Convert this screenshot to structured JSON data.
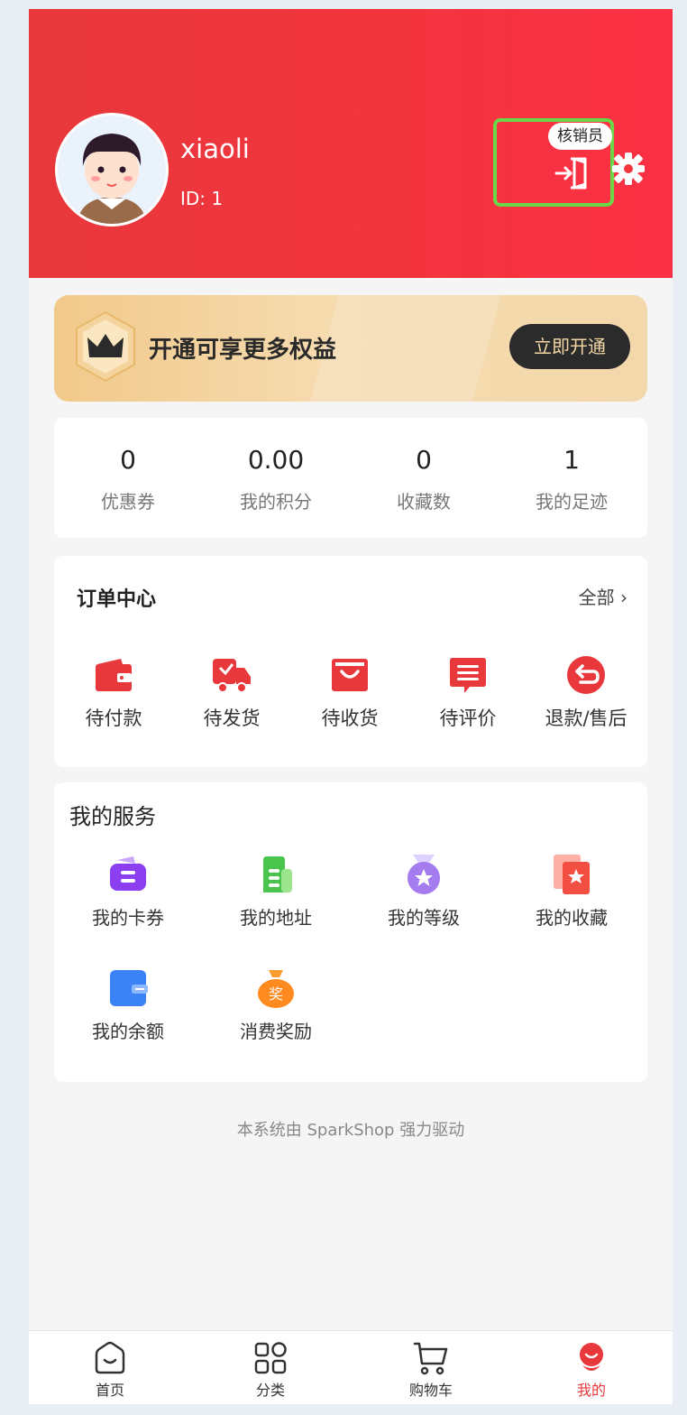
{
  "header": {
    "username": "xiaoli",
    "user_id": "ID: 1",
    "verifier_badge": "核销员"
  },
  "vip": {
    "text": "开通可享更多权益",
    "button": "立即开通"
  },
  "stats": [
    {
      "value": "0",
      "label": "优惠券"
    },
    {
      "value": "0.00",
      "label": "我的积分"
    },
    {
      "value": "0",
      "label": "收藏数"
    },
    {
      "value": "1",
      "label": "我的足迹"
    }
  ],
  "orders": {
    "title": "订单中心",
    "view_all": "全部 ›",
    "items": [
      {
        "label": "待付款",
        "icon": "wallet-icon"
      },
      {
        "label": "待发货",
        "icon": "truck-icon"
      },
      {
        "label": "待收货",
        "icon": "bag-icon"
      },
      {
        "label": "待评价",
        "icon": "comment-icon"
      },
      {
        "label": "退款/售后",
        "icon": "refund-icon"
      }
    ]
  },
  "services": {
    "title": "我的服务",
    "items": [
      {
        "label": "我的卡券",
        "icon": "coupon-icon"
      },
      {
        "label": "我的地址",
        "icon": "address-icon"
      },
      {
        "label": "我的等级",
        "icon": "medal-icon"
      },
      {
        "label": "我的收藏",
        "icon": "favorite-icon"
      },
      {
        "label": "我的余额",
        "icon": "balance-icon"
      },
      {
        "label": "消费奖励",
        "icon": "reward-bag-icon",
        "icon_text": "奖"
      }
    ]
  },
  "footer": {
    "powered_by": "本系统由 SparkShop 强力驱动"
  },
  "tabbar": [
    {
      "label": "首页",
      "icon": "home-icon"
    },
    {
      "label": "分类",
      "icon": "category-icon"
    },
    {
      "label": "购物车",
      "icon": "cart-icon"
    },
    {
      "label": "我的",
      "icon": "profile-icon",
      "active": true
    }
  ],
  "colors": {
    "brand_red": "#e8383b",
    "highlight_green": "#6bd84a",
    "vip_gold": "#f1c98a"
  }
}
